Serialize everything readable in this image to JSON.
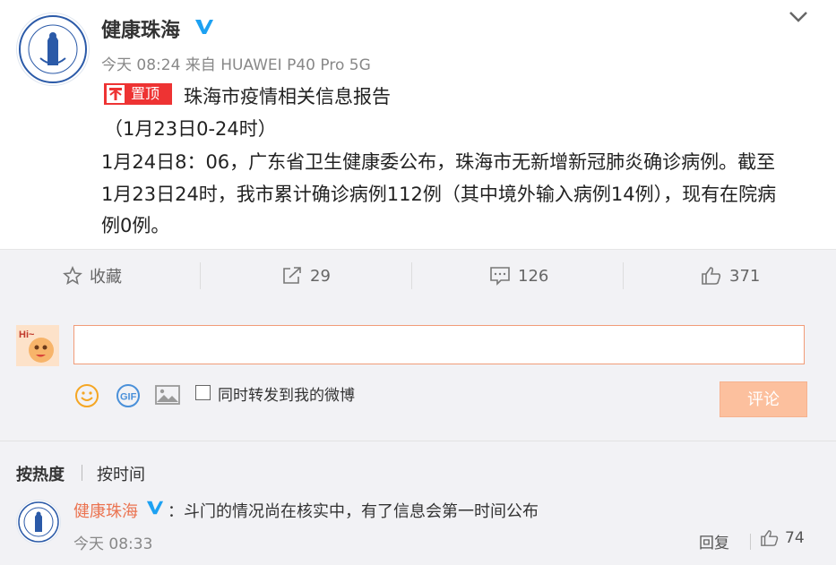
{
  "post": {
    "username": "健康珠海",
    "meta": "今天 08:24 来自 HUAWEI P40 Pro 5G",
    "pin_label": "置顶",
    "lines": [
      "珠海市疫情相关信息报告",
      "（1月23日0-24时）",
      "1月24日8：06，广东省卫生健康委公布，珠海市无新增新冠肺炎确诊病例。截至",
      "1月23日24时，我市累计确诊病例112例（其中境外输入病例14例），现有在院病",
      "例0例。"
    ]
  },
  "actions": {
    "favorite": "收藏",
    "repost": "29",
    "comments": "126",
    "likes": "371"
  },
  "composer": {
    "forward_label": "同时转发到我的微博",
    "submit_label": "评论"
  },
  "sort": {
    "hot": "按热度",
    "time": "按时间"
  },
  "comment": {
    "username": "健康珠海",
    "text": "：斗门的情况尚在核实中，有了信息会第一时间公布",
    "time": "今天 08:33",
    "reply": "回复",
    "likes": "74"
  },
  "colors": {
    "pin_red": "#e33333",
    "verified": "#1da1f2",
    "comment_user": "#eb7350",
    "submit_bg": "#fcc09e"
  },
  "icons": [
    "verified-icon",
    "chevron-down-icon",
    "pin-icon",
    "star-icon",
    "repost-icon",
    "comment-icon",
    "like-icon",
    "emoji-icon",
    "gif-icon",
    "image-icon"
  ]
}
